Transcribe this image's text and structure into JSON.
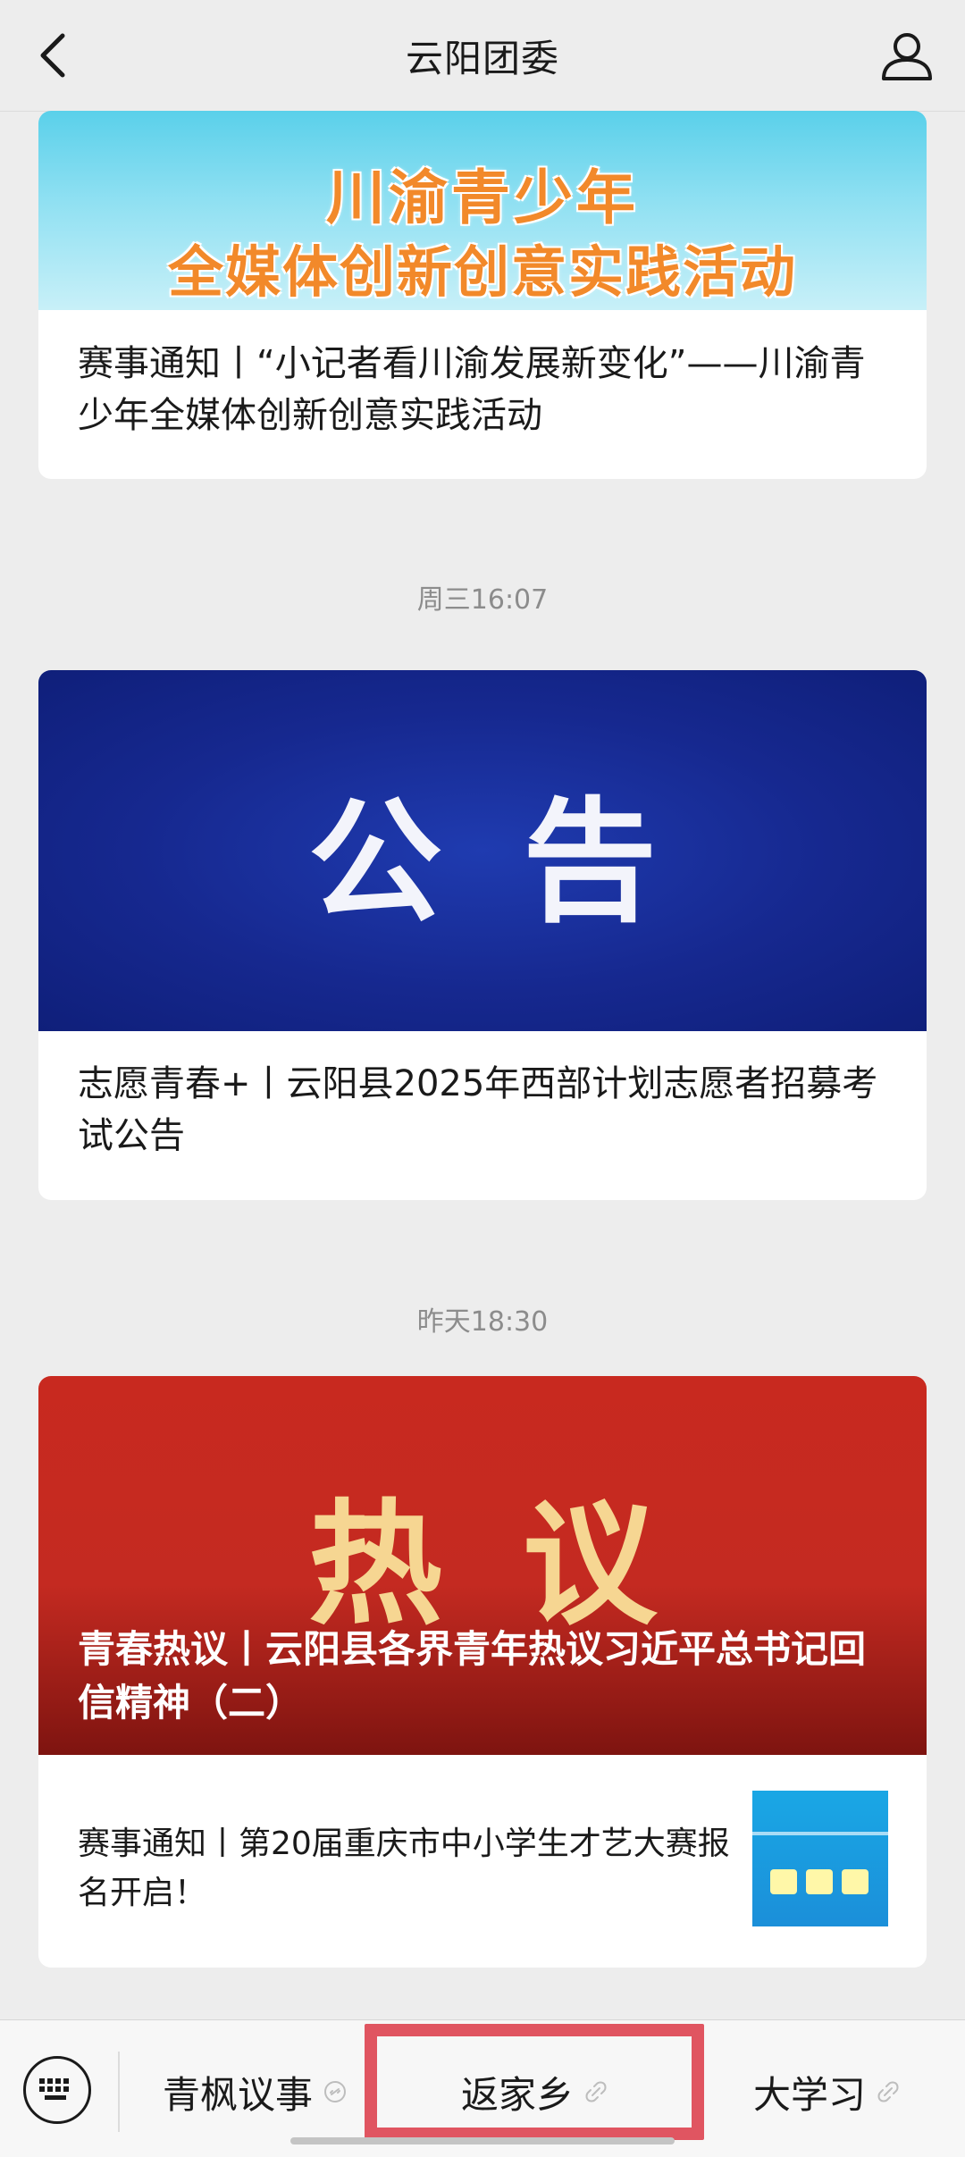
{
  "header": {
    "title": "云阳团委"
  },
  "card1": {
    "banner_line1": "川渝青少年",
    "banner_line2": "全媒体创新创意实践活动",
    "caption": "赛事通知丨“小记者看川渝发展新变化”——川渝青少年全媒体创新创意实践活动"
  },
  "timestamp1": "周三16:07",
  "card2": {
    "banner_text": "公告",
    "caption": "志愿青春+丨云阳县2025年西部计划志愿者招募考试公告"
  },
  "timestamp2": "昨天18:30",
  "card3": {
    "banner_text": "热议",
    "title": "青春热议丨云阳县各界青年热议习近平总书记回信精神（二）",
    "sub_title": "赛事通知丨第20届重庆市中小学生才艺大赛报名开启！"
  },
  "bottom_menu": {
    "items": [
      {
        "label": "青枫议事",
        "icon": "link-icon"
      },
      {
        "label": "返家乡",
        "icon": "link-icon"
      },
      {
        "label": "大学习",
        "icon": "link-icon"
      }
    ]
  },
  "colors": {
    "background": "#ededed",
    "highlight": "#e05561",
    "banner_blue": "#16288f",
    "banner_red": "#c42a21"
  }
}
